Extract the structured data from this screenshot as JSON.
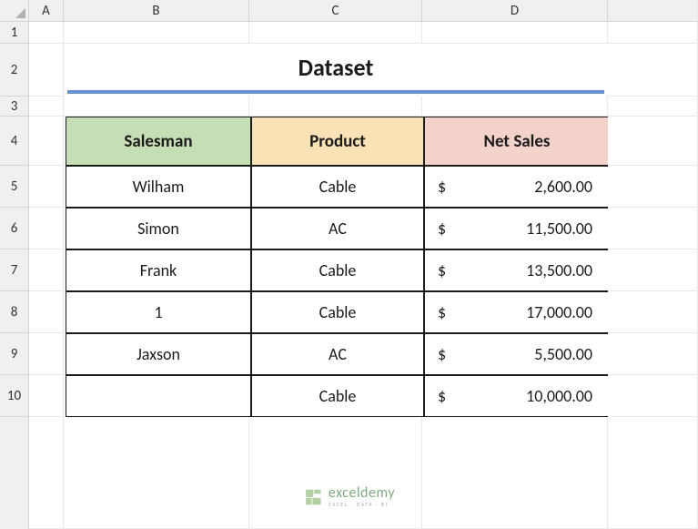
{
  "columns": [
    "A",
    "B",
    "C",
    "D"
  ],
  "rows": [
    "1",
    "2",
    "3",
    "4",
    "5",
    "6",
    "7",
    "8",
    "9",
    "10"
  ],
  "title": "Dataset",
  "table": {
    "headers": {
      "col1": "Salesman",
      "col2": "Product",
      "col3": "Net Sales"
    },
    "rows": [
      {
        "salesman": "Wilham",
        "product": "Cable",
        "currency": "$",
        "amount": "2,600.00"
      },
      {
        "salesman": "Simon",
        "product": "AC",
        "currency": "$",
        "amount": "11,500.00"
      },
      {
        "salesman": "Frank",
        "product": "Cable",
        "currency": "$",
        "amount": "13,500.00"
      },
      {
        "salesman": "1",
        "product": "Cable",
        "currency": "$",
        "amount": "17,000.00"
      },
      {
        "salesman": "Jaxson",
        "product": "AC",
        "currency": "$",
        "amount": "5,500.00"
      },
      {
        "salesman": "",
        "product": "Cable",
        "currency": "$",
        "amount": "10,000.00"
      }
    ]
  },
  "watermark": {
    "main": "exceldemy",
    "sub": "EXCEL · DATA · BI"
  },
  "chart_data": {
    "type": "table",
    "title": "Dataset",
    "columns": [
      "Salesman",
      "Product",
      "Net Sales"
    ],
    "rows": [
      [
        "Wilham",
        "Cable",
        2600.0
      ],
      [
        "Simon",
        "AC",
        11500.0
      ],
      [
        "Frank",
        "Cable",
        13500.0
      ],
      [
        "1",
        "Cable",
        17000.0
      ],
      [
        "Jaxson",
        "AC",
        5500.0
      ],
      [
        "",
        "Cable",
        10000.0
      ]
    ]
  }
}
